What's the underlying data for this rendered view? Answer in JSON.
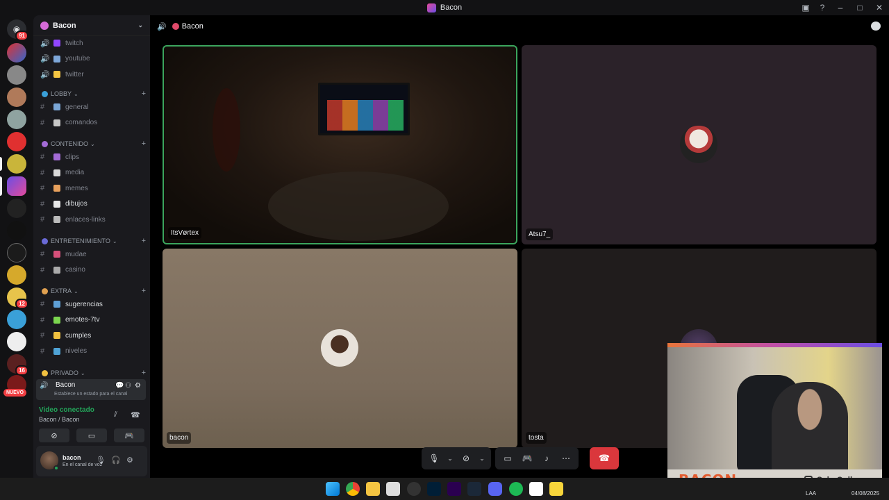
{
  "window": {
    "title": "Bacon"
  },
  "rail": {
    "dm_badge": "91",
    "badges": {
      "server_12": "12",
      "server_16": "16"
    },
    "new_label": "NUEVO"
  },
  "sidebar": {
    "guild_name": "Bacon",
    "channels_top": [
      {
        "name": "twitch",
        "color": "#9146ff"
      },
      {
        "name": "youtube",
        "color": "#7da7d9"
      },
      {
        "name": "twitter",
        "color": "#f5c542"
      }
    ],
    "categories": [
      {
        "name": "LOBBY",
        "channels": [
          {
            "name": "general",
            "read": false
          },
          {
            "name": "comandos",
            "read": false
          }
        ]
      },
      {
        "name": "CONTENIDO",
        "channels": [
          {
            "name": "clips",
            "read": false
          },
          {
            "name": "media",
            "read": false
          },
          {
            "name": "memes",
            "read": false
          },
          {
            "name": "dibujos",
            "read": true
          },
          {
            "name": "enlaces-links",
            "read": false
          }
        ]
      },
      {
        "name": "ENTRETENIMIENTO",
        "channels": [
          {
            "name": "mudae",
            "read": false
          },
          {
            "name": "casino",
            "read": false
          }
        ]
      },
      {
        "name": "EXTRA",
        "channels": [
          {
            "name": "sugerencias",
            "read": true
          },
          {
            "name": "emotes-7tv",
            "read": true
          },
          {
            "name": "cumples",
            "read": true
          },
          {
            "name": "niveles",
            "read": false
          }
        ]
      },
      {
        "name": "PRIVADO",
        "channels": []
      }
    ],
    "voice_channel": {
      "name": "Bacon",
      "status_placeholder": "Establece un estado para el canal"
    },
    "voice_panel": {
      "title": "Video conectado",
      "subtitle": "Bacon / Bacon"
    },
    "user": {
      "name": "bacon",
      "status": "En el canal de voz"
    }
  },
  "main": {
    "header_channel": "Bacon",
    "tiles": [
      {
        "name": "ItsVørtex"
      },
      {
        "name": "Atsu7_"
      },
      {
        "name": "bacon"
      },
      {
        "name": "tosta"
      }
    ]
  },
  "webcam": {
    "brand": "BACON",
    "instagram": "SebaCollares"
  },
  "taskbar": {
    "lang": "LAA",
    "date": "04/08/2025"
  },
  "colors": {
    "accent_green": "#23a55a",
    "hangup_red": "#da373c",
    "badge_red": "#f23f43"
  },
  "icons": [
    "speaker-icon",
    "chat-icon",
    "mic-icon",
    "camera-off-icon",
    "screen-share-icon",
    "activity-icon",
    "soundboard-icon",
    "more-icon",
    "hang-up-icon",
    "headphones-icon",
    "gear-icon"
  ]
}
